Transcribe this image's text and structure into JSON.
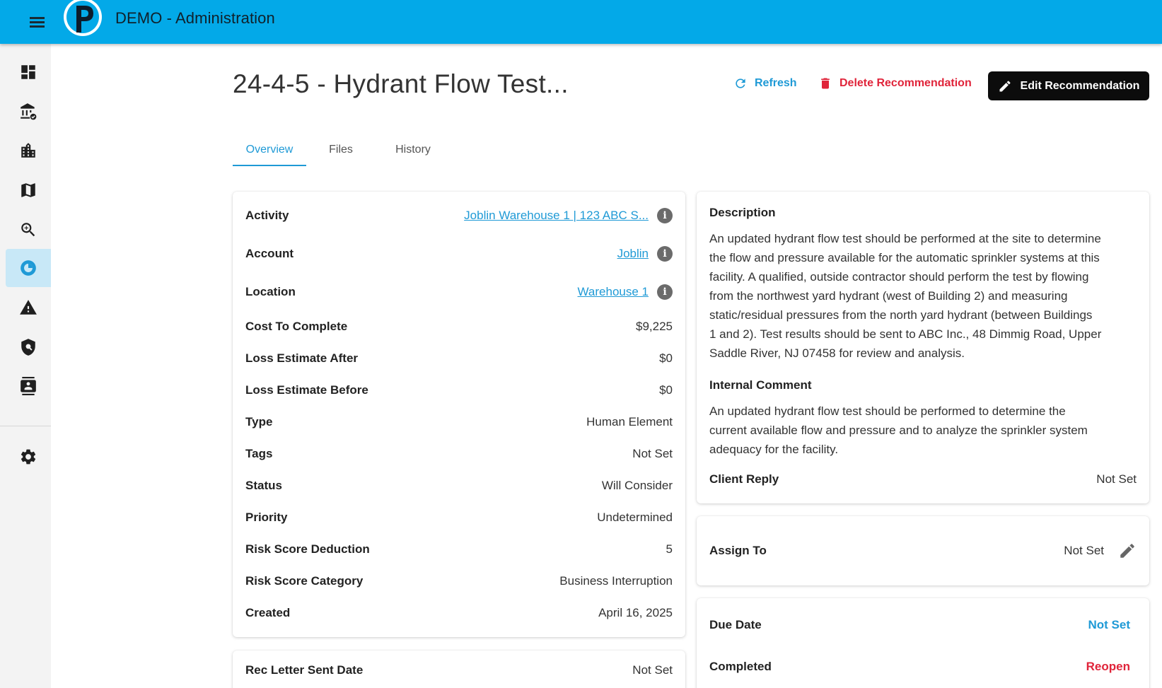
{
  "app": {
    "title": "DEMO - Administration"
  },
  "colors": {
    "header": "#03a9e8",
    "accent": "#1f9ad6",
    "danger": "#e0243a",
    "active_nav": "#c8e8f7"
  },
  "sidebar": {
    "items": [
      {
        "icon": "dashboard-icon"
      },
      {
        "icon": "institution-icon"
      },
      {
        "icon": "buildings-icon"
      },
      {
        "icon": "map-icon"
      },
      {
        "icon": "zoom-in-icon"
      },
      {
        "icon": "recommendation-icon",
        "active": true
      },
      {
        "icon": "warning-icon"
      },
      {
        "icon": "shield-icon"
      },
      {
        "icon": "contacts-icon"
      },
      {
        "icon": "settings-icon"
      }
    ]
  },
  "page": {
    "title": "24-4-5 - Hydrant Flow Test...",
    "actions": {
      "refresh": "Refresh",
      "delete": "Delete Recommendation",
      "edit": "Edit Recommendation"
    }
  },
  "tabs": [
    {
      "label": "Overview",
      "active": true
    },
    {
      "label": "Files"
    },
    {
      "label": "History"
    }
  ],
  "details": {
    "activity": {
      "label": "Activity",
      "value": "Joblin Warehouse 1 | 123 ABC S..."
    },
    "account": {
      "label": "Account",
      "value": "Joblin"
    },
    "location": {
      "label": "Location",
      "value": "Warehouse 1"
    },
    "cost": {
      "label": "Cost To Complete",
      "value": "$9,225"
    },
    "loss_after": {
      "label": "Loss Estimate After",
      "value": "$0"
    },
    "loss_before": {
      "label": "Loss Estimate Before",
      "value": "$0"
    },
    "type": {
      "label": "Type",
      "value": "Human Element"
    },
    "tags": {
      "label": "Tags",
      "value": "Not Set"
    },
    "status": {
      "label": "Status",
      "value": "Will Consider"
    },
    "priority": {
      "label": "Priority",
      "value": "Undetermined"
    },
    "risk_deduction": {
      "label": "Risk Score Deduction",
      "value": "5"
    },
    "risk_category": {
      "label": "Risk Score Category",
      "value": "Business Interruption"
    },
    "created": {
      "label": "Created",
      "value": "April 16, 2025"
    }
  },
  "rec_letter": {
    "label": "Rec Letter Sent Date",
    "value": "Not Set"
  },
  "description": {
    "title": "Description",
    "lines": [
      "An updated hydrant flow test should be performed at the site to determine",
      "the flow and pressure available for the automatic sprinkler systems at this",
      "facility. A qualified, outside contractor should perform the test by flowing",
      "from the northwest yard hydrant (west of Building 2) and measuring",
      "static/residual pressures from the north yard hydrant (between Buildings",
      "1 and 2). Test results should be sent to ABC Inc., 48 Dimmig Road, Upper",
      "Saddle River, NJ 07458 for review and analysis."
    ]
  },
  "internal_comment": {
    "title": "Internal Comment",
    "lines": [
      "An updated hydrant flow test should be performed to determine the",
      "current available flow and pressure and to analyze the sprinkler system",
      "adequacy for the facility."
    ]
  },
  "client_reply": {
    "label": "Client Reply",
    "value": "Not Set"
  },
  "assign": {
    "label": "Assign To",
    "value": "Not Set"
  },
  "due": {
    "label": "Due Date",
    "value": "Not Set"
  },
  "completed": {
    "label": "Completed",
    "value": "Reopen"
  }
}
